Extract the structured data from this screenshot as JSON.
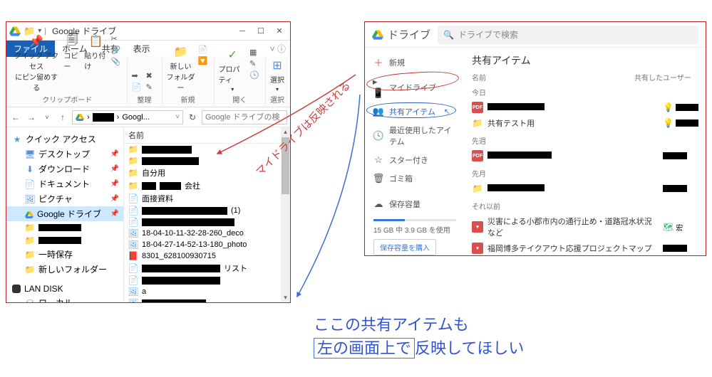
{
  "explorer": {
    "title": "Google ドライブ",
    "tabs": {
      "file": "ファイル",
      "home": "ホーム",
      "share": "共有",
      "view": "表示"
    },
    "ribbon": {
      "quick_access": "クイック アクセス\nにピン留めする",
      "copy": "コピー",
      "paste": "貼り付け",
      "new_folder": "新しい\nフォルダー",
      "properties": "プロパティ",
      "select": "選択",
      "groups": {
        "clipboard": "クリップボード",
        "organize": "整理",
        "new": "新規",
        "open": "開く",
        "select": "選択"
      }
    },
    "address": {
      "prefix_icon": "gdrive",
      "crumbs": [
        "Googl..."
      ],
      "refresh_label": "↻"
    },
    "search_placeholder": "Google ドライブの検",
    "nav_pane": {
      "quick_access": "クイック アクセス",
      "items": [
        {
          "label": "デスクトップ",
          "pinned": true,
          "icon": "desktop"
        },
        {
          "label": "ダウンロード",
          "pinned": true,
          "icon": "download"
        },
        {
          "label": "ドキュメント",
          "pinned": true,
          "icon": "document"
        },
        {
          "label": "ピクチャ",
          "pinned": true,
          "icon": "picture"
        },
        {
          "label": "Google ドライブ",
          "pinned": true,
          "icon": "gdrive",
          "selected": true
        },
        {
          "label": "",
          "redact": true,
          "pinned": false,
          "icon": "folder"
        },
        {
          "label": "",
          "redact": true,
          "pinned": false,
          "icon": "folder"
        },
        {
          "label": "一時保存",
          "pinned": false,
          "icon": "folder"
        },
        {
          "label": "新しいフォルダー",
          "pinned": false,
          "icon": "folder"
        }
      ],
      "landisk": "LAN DISK",
      "local": "ローカル"
    },
    "column_header": "名前",
    "files": [
      {
        "icon": "folder",
        "label": "",
        "redact_w": 70
      },
      {
        "icon": "folder",
        "label": "",
        "redact_w": 80
      },
      {
        "icon": "folder",
        "label": "自分用"
      },
      {
        "icon": "folder",
        "label": "",
        "redact_pre": 20,
        "text_mid": "    ",
        "redact_suf": 30,
        "suffix": "会社"
      },
      {
        "icon": "doc-blue",
        "label": "面接資料"
      },
      {
        "icon": "doc-blue",
        "label": "",
        "redact_w": 120,
        "suffix": " (1)"
      },
      {
        "icon": "doc-blue",
        "label": "",
        "redact_w": 130
      },
      {
        "icon": "img",
        "label": "18-04-10-11-32-28-260_deco"
      },
      {
        "icon": "img",
        "label": "18-04-27-14-52-13-180_photo"
      },
      {
        "icon": "pdf",
        "label": "8301_628100930715"
      },
      {
        "icon": "doc-blue",
        "label": "",
        "redact_w": 110,
        "suffix": "リスト"
      },
      {
        "icon": "doc-blue",
        "label": "",
        "redact_w": 110
      },
      {
        "icon": "img",
        "label": "a"
      },
      {
        "icon": "img",
        "label": "",
        "redact_w": 90
      }
    ]
  },
  "drive_web": {
    "brand": "ドライブ",
    "search_placeholder": "ドライブで検索",
    "side": {
      "new": "新規",
      "my_drive": "マイドライブ",
      "shared": "共有アイテム",
      "recent": "最近使用したアイテム",
      "starred": "スター付き",
      "trash": "ゴミ箱",
      "storage": "保存容量"
    },
    "storage_text": "15 GB 中 3.9 GB を使用",
    "storage_btn": "保存容量を購入",
    "main_title": "共有アイテム",
    "cols": {
      "name": "名前",
      "user": "共有したユーザー"
    },
    "sections": {
      "today": "今日",
      "last_week": "先週",
      "last_month": "先月",
      "older": "それ以前"
    },
    "rows": {
      "today": [
        {
          "icon": "pdf",
          "label": "",
          "redact_w": 80,
          "user_icon": "bulb",
          "user_redact": true
        },
        {
          "icon": "folder-dark",
          "label": "共有テスト用",
          "user_icon": "bulb",
          "user_redact": true
        }
      ],
      "last_week": [
        {
          "icon": "pdf",
          "label": "",
          "redact_w": 90,
          "user_redact": true
        }
      ],
      "last_month": [
        {
          "icon": "folder-dark",
          "label": "",
          "redact_w": 80,
          "user_redact": true
        }
      ],
      "older": [
        {
          "icon": "map-red",
          "label": "災害による小郡市内の通行止め・道路冠水状況など",
          "user_icon": "map-green",
          "user_suffix": "宏"
        },
        {
          "icon": "map-red",
          "label": "福岡博多テイクアウト応援プロジェクトマップ",
          "user_redact": true
        }
      ]
    }
  },
  "annotations": {
    "mydrive_note": "マイドライブは反映される",
    "bottom1": "ここの共有アイテムも",
    "bottom2_pre": "左の画面上で",
    "bottom2_box": "反映してほしい"
  }
}
